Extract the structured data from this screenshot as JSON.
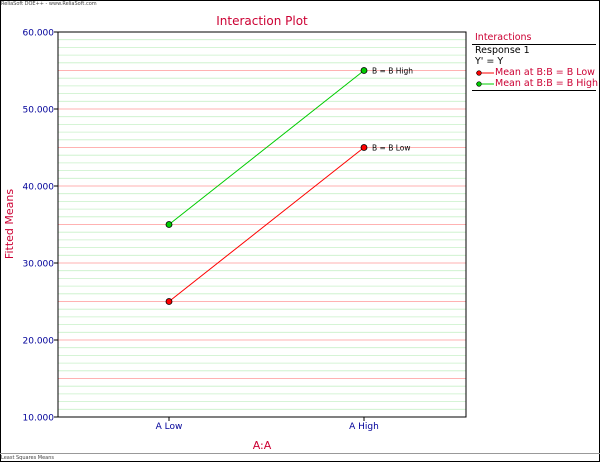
{
  "header": {
    "text": "ReliaSoft DOE++ - www.ReliaSoft.com"
  },
  "footer": {
    "text": "Least Squares Means"
  },
  "colors": {
    "accent": "#cc0033",
    "axis_text": "#000099",
    "series_low": "#ff0000",
    "series_high": "#00cc00"
  },
  "chart_data": {
    "type": "line",
    "title": "Interaction Plot",
    "xlabel": "A:A",
    "ylabel": "Fitted Means",
    "categories": [
      "A Low",
      "A High"
    ],
    "ylim": [
      10,
      60
    ],
    "y_ticks": [
      "10.000",
      "20.000",
      "30.000",
      "40.000",
      "50.000",
      "60.000"
    ],
    "grid": true,
    "legend_position": "right",
    "series": [
      {
        "name": "Mean at B:B = B Low",
        "end_label": "B = B Low",
        "values": [
          25,
          45
        ],
        "color": "#ff0000"
      },
      {
        "name": "Mean at B:B = B High",
        "end_label": "B = B High",
        "values": [
          35,
          55
        ],
        "color": "#00cc00"
      }
    ]
  },
  "legend": {
    "title": "Interactions",
    "subtitle_1": "Response 1",
    "subtitle_2": "Y' = Y",
    "items": [
      {
        "label": "Mean at B:B = B Low",
        "color": "#ff0000"
      },
      {
        "label": "Mean at B:B = B High",
        "color": "#00cc00"
      }
    ]
  }
}
